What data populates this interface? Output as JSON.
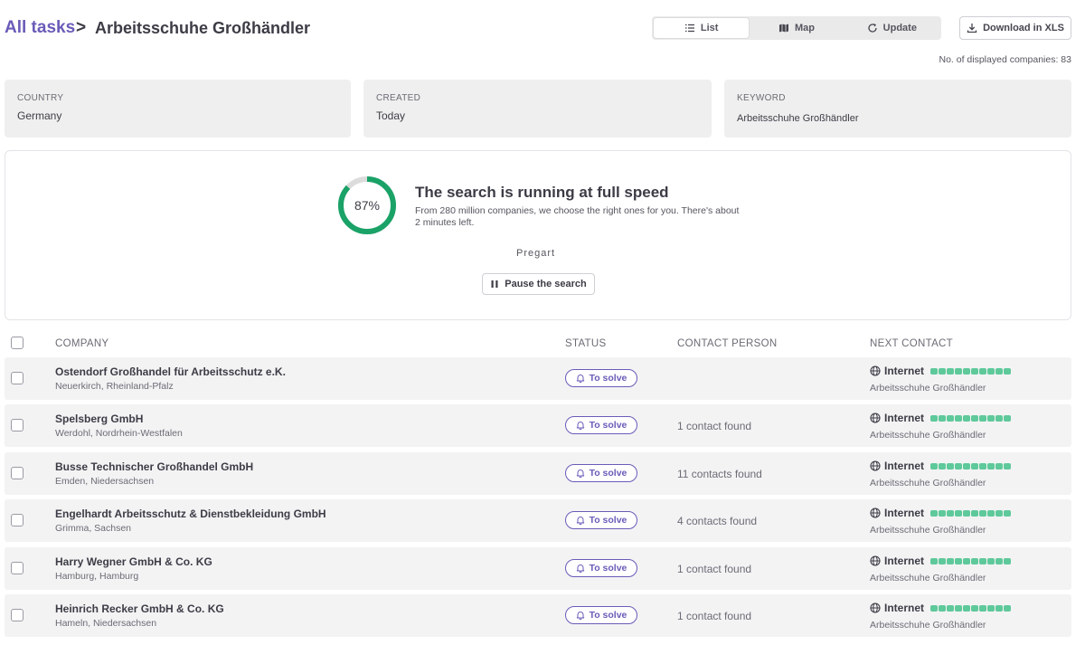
{
  "breadcrumb": {
    "root": "All tasks",
    "separator": ">",
    "title": "Arbeitsschuhe Großhändler"
  },
  "view_switch": {
    "list": "List",
    "map": "Map",
    "update": "Update"
  },
  "download_label": "Download in XLS",
  "count_label": "No. of displayed companies: 83",
  "filters": {
    "country": {
      "label": "COUNTRY",
      "value": "Germany"
    },
    "created": {
      "label": "CREATED",
      "value": "Today"
    },
    "keyword": {
      "label": "KEYWORD",
      "value": "Arbeitsschuhe Großhändler"
    }
  },
  "progress": {
    "percent": 87,
    "percent_text": "87%",
    "title": "The search is running at full speed",
    "description": "From 280 million companies, we choose the right ones for you. There's about 2 minutes left.",
    "status": "Pregart",
    "pause_label": "Pause the search",
    "colors": {
      "progress": "#1aa267",
      "track": "#dcdcdc"
    }
  },
  "table": {
    "headers": {
      "company": "COMPANY",
      "status": "STATUS",
      "contact": "CONTACT PERSON",
      "next": "NEXT CONTACT"
    },
    "rows": [
      {
        "name": "Ostendorf Großhandel für Arbeitsschutz e.K.",
        "location": "Neuerkirch, Rheinland-Pfalz",
        "status": "To solve",
        "contact": "",
        "channel": "Internet",
        "keyword": "Arbeitsschuhe Großhändler"
      },
      {
        "name": "Spelsberg GmbH",
        "location": "Werdohl, Nordrhein-Westfalen",
        "status": "To solve",
        "contact": "1 contact found",
        "channel": "Internet",
        "keyword": "Arbeitsschuhe Großhändler"
      },
      {
        "name": "Busse Technischer Großhandel GmbH",
        "location": "Emden, Niedersachsen",
        "status": "To solve",
        "contact": "11 contacts found",
        "channel": "Internet",
        "keyword": "Arbeitsschuhe Großhändler"
      },
      {
        "name": "Engelhardt Arbeitsschutz & Dienstbekleidung GmbH",
        "location": "Grimma, Sachsen",
        "status": "To solve",
        "contact": "4 contacts found",
        "channel": "Internet",
        "keyword": "Arbeitsschuhe Großhändler"
      },
      {
        "name": "Harry Wegner GmbH & Co. KG",
        "location": "Hamburg, Hamburg",
        "status": "To solve",
        "contact": "1 contact found",
        "channel": "Internet",
        "keyword": "Arbeitsschuhe Großhändler"
      },
      {
        "name": "Heinrich Recker GmbH & Co. KG",
        "location": "Hameln, Niedersachsen",
        "status": "To solve",
        "contact": "1 contact found",
        "channel": "Internet",
        "keyword": "Arbeitsschuhe Großhändler"
      }
    ]
  },
  "colors": {
    "accent": "#6a5bb8",
    "bar": "#5ec99a"
  }
}
